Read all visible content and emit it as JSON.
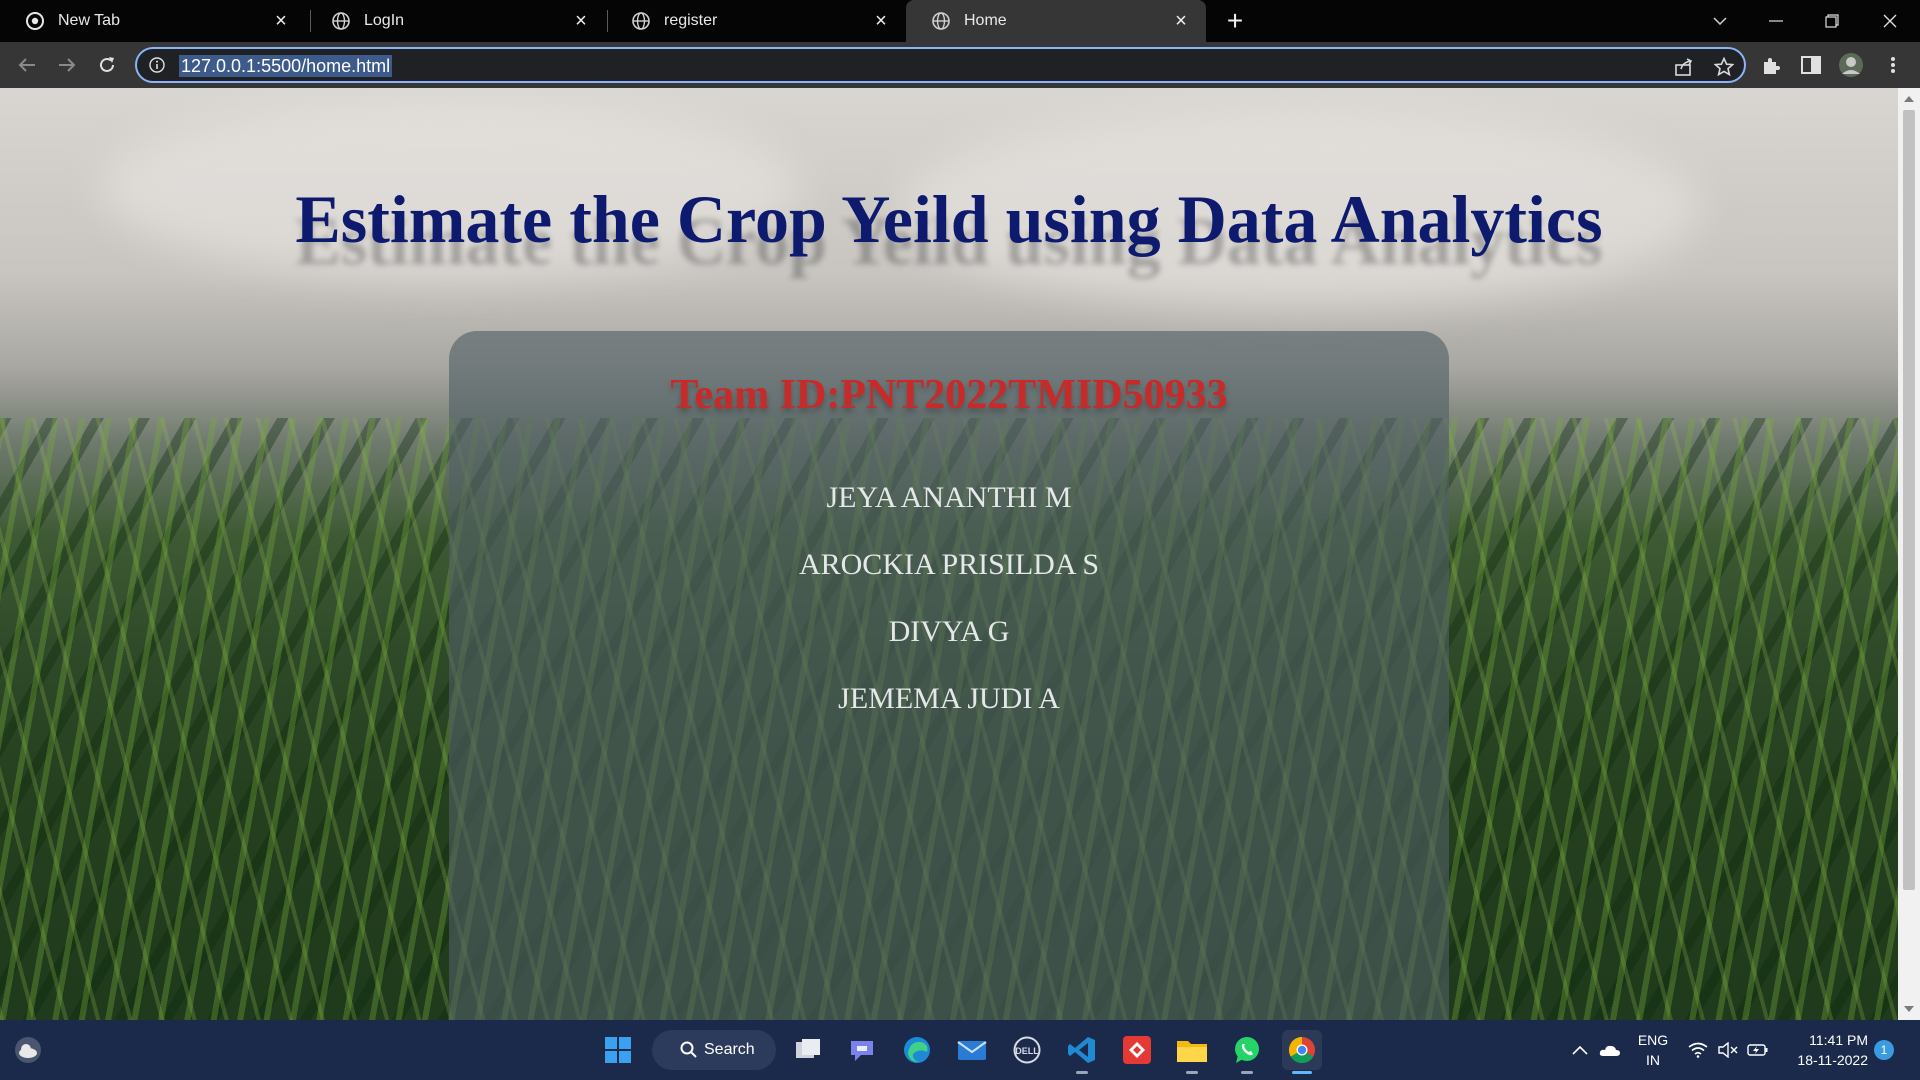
{
  "browser": {
    "tabs": [
      {
        "title": "New Tab",
        "icon": "chrome-icon",
        "active": false
      },
      {
        "title": "LogIn",
        "icon": "globe-icon",
        "active": false
      },
      {
        "title": "register",
        "icon": "globe-icon",
        "active": false
      },
      {
        "title": "Home",
        "icon": "globe-icon",
        "active": true
      }
    ],
    "address": "127.0.0.1:5500/home.html"
  },
  "page": {
    "title": "Estimate the Crop Yeild using Data Analytics",
    "team_id": "Team ID:PNT2022TMID50933",
    "members": [
      "JEYA ANANTHI M",
      "AROCKIA PRISILDA S",
      "DIVYA G",
      "JEMEMA JUDI A"
    ]
  },
  "taskbar": {
    "search_label": "Search",
    "language": "ENG",
    "region": "IN",
    "time": "11:41 PM",
    "date": "18-11-2022",
    "notification_count": "1"
  },
  "colors": {
    "title": "#0d1a6e",
    "team_id": "#c82a2a",
    "accent": "#8ab4f8",
    "taskbar": "#1b2a4a"
  }
}
